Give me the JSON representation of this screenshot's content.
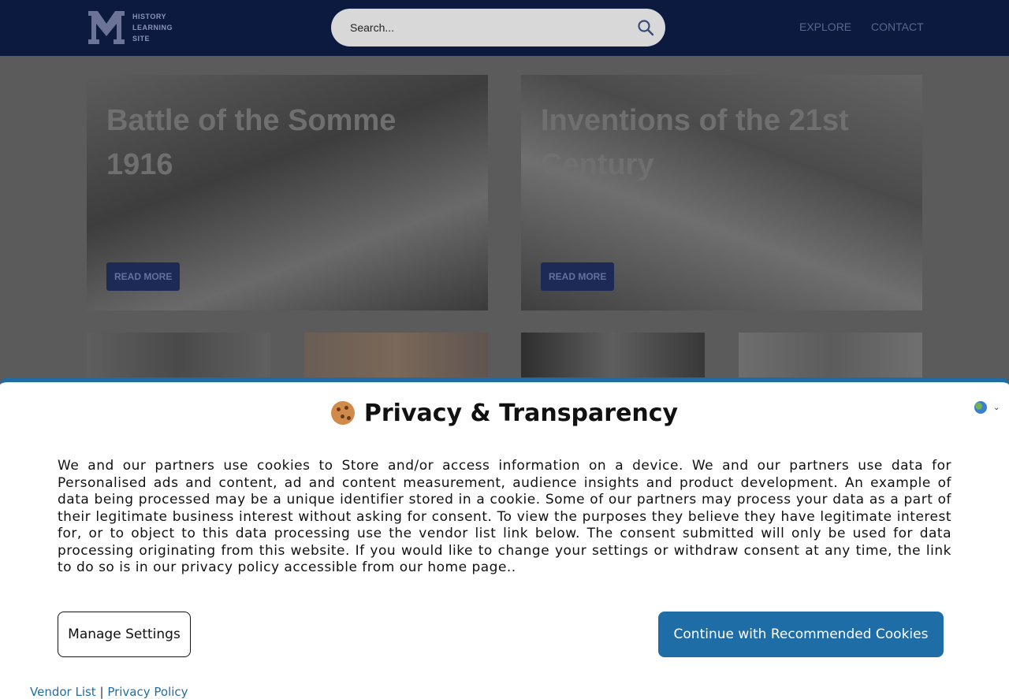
{
  "header": {
    "logo_text_lines": [
      "HISTORY",
      "LEARNING",
      "SITE"
    ],
    "search_placeholder": "Search...",
    "nav": [
      "EXPLORE",
      "CONTACT"
    ]
  },
  "hero_cards": [
    {
      "title": "Battle of the Somme 1916",
      "button": "READ MORE"
    },
    {
      "title": "Inventions of the 21st Century",
      "button": "READ MORE"
    }
  ],
  "consent": {
    "title": "Privacy & Transparency",
    "body": "We and our partners use cookies to Store and/or access information on a device. We and our partners use data for Personalised ads and content, ad and content measurement, audience insights and product development. An example of data being processed may be a unique identifier stored in a cookie. Some of our partners may process your data as a part of their legitimate business interest without asking for consent. To view the purposes they believe they have legitimate interest for, or to object to this data processing use the vendor list link below. The consent submitted will only be used for data processing originating from this website. If you would like to change your settings or withdraw consent at any time, the link to do so is in our privacy policy accessible from our home page..",
    "manage_label": "Manage Settings",
    "continue_label": "Continue with Recommended Cookies",
    "vendor_link": "Vendor List",
    "separator": "|",
    "privacy_link": "Privacy Policy",
    "language_icon": "globe-icon"
  },
  "colors": {
    "header_bg": "#0c1a40",
    "accent": "#1f6da7",
    "overlay_dim": "#5a5a5a"
  }
}
